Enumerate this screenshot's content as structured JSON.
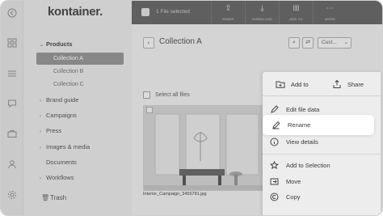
{
  "brand": {
    "logo_text": "kontainer."
  },
  "rail": {
    "icons": [
      "back-arrow-icon",
      "grid-icon",
      "list-icon",
      "chat-icon",
      "briefcase-icon",
      "user-icon",
      "settings-icon"
    ]
  },
  "sidebar": {
    "items": [
      {
        "label": "Products",
        "expanded": true
      },
      {
        "label": "Brand guide"
      },
      {
        "label": "Campaigns"
      },
      {
        "label": "Press"
      },
      {
        "label": "Images & media"
      },
      {
        "label": "Documents"
      },
      {
        "label": "Workflows"
      }
    ],
    "subitems": [
      {
        "label": "Collection A",
        "active": true
      },
      {
        "label": "Collection B"
      },
      {
        "label": "Collection C"
      }
    ],
    "trash": "Trash"
  },
  "topbar": {
    "selected_text": "1 File selected",
    "actions": [
      {
        "label": "SHARE",
        "icon": "share-icon"
      },
      {
        "label": "DOWNLOAD",
        "icon": "download-icon"
      },
      {
        "label": "ADD TO",
        "icon": "add-to-icon"
      },
      {
        "label": "MORE",
        "icon": "more-icon"
      }
    ]
  },
  "content": {
    "collection_title": "Collection A",
    "sort_select": "Cust...",
    "select_all": "Select all files",
    "file": {
      "name": "Interior_Campaign_3456781.jpg"
    }
  },
  "context_menu": {
    "add_to": "Add to",
    "share": "Share",
    "items": [
      {
        "label": "Edit file data",
        "icon": "edit-data-icon"
      },
      {
        "label": "Rename",
        "icon": "pencil-icon",
        "highlighted": true
      },
      {
        "label": "View details",
        "icon": "info-icon"
      },
      {
        "label": "Add to Selection",
        "icon": "star-icon"
      },
      {
        "label": "Move",
        "icon": "move-icon"
      },
      {
        "label": "Copy",
        "icon": "copy-icon"
      }
    ]
  },
  "colors": {
    "topbar": "#5c5c5c",
    "active_nav": "#8d8d8d",
    "menu_bg": "#ededed",
    "highlight": "#ffffff"
  }
}
